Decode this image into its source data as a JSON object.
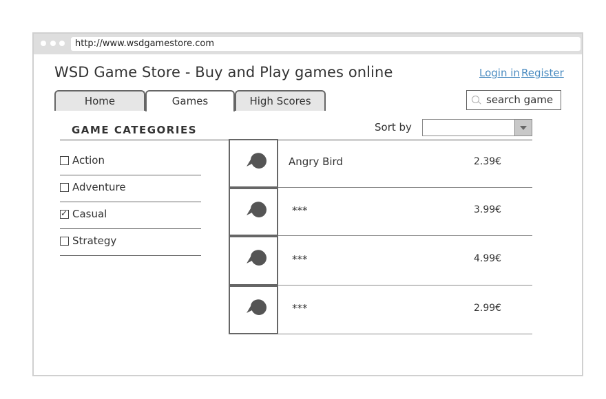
{
  "browser": {
    "url": "http://www.wsdgamestore.com"
  },
  "header": {
    "title": "WSD Game Store - Buy and Play games online",
    "login_label": "Login in",
    "register_label": "Register"
  },
  "tabs": [
    {
      "label": "Home",
      "active": false
    },
    {
      "label": "Games",
      "active": true
    },
    {
      "label": "High Scores",
      "active": false
    }
  ],
  "search": {
    "placeholder": "search game",
    "icon": "search-icon"
  },
  "categories": {
    "header": "GAME CATEGORIES",
    "items": [
      {
        "label": "Action",
        "checked": false
      },
      {
        "label": "Adventure",
        "checked": false
      },
      {
        "label": "Casual",
        "checked": true
      },
      {
        "label": "Strategy",
        "checked": false
      }
    ]
  },
  "sort": {
    "label": "Sort by",
    "selected": ""
  },
  "games": [
    {
      "name": "Angry Bird",
      "price": "2.39€",
      "icon": "image-placeholder-icon"
    },
    {
      "name": "***",
      "price": "3.99€",
      "icon": "image-placeholder-icon"
    },
    {
      "name": "***",
      "price": "4.99€",
      "icon": "image-placeholder-icon"
    },
    {
      "name": "***",
      "price": "2.99€",
      "icon": "image-placeholder-icon"
    }
  ],
  "colors": {
    "link": "#4a8bc0",
    "frame": "#d0d0d0",
    "titlebar": "#dedede"
  }
}
